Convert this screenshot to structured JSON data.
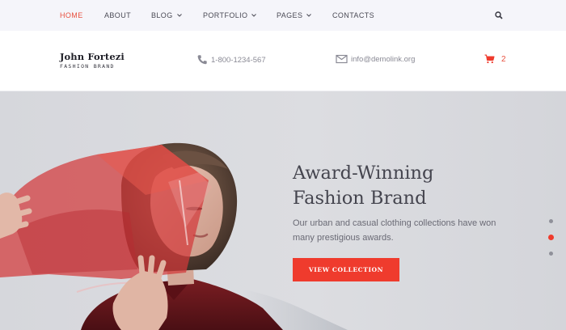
{
  "nav": {
    "items": [
      {
        "label": "HOME",
        "active": true,
        "has_dropdown": false
      },
      {
        "label": "ABOUT",
        "active": false,
        "has_dropdown": false
      },
      {
        "label": "BLOG",
        "active": false,
        "has_dropdown": true
      },
      {
        "label": "PORTFOLIO",
        "active": false,
        "has_dropdown": true
      },
      {
        "label": "PAGES",
        "active": false,
        "has_dropdown": true
      },
      {
        "label": "CONTACTS",
        "active": false,
        "has_dropdown": false
      }
    ],
    "search_icon": "search-icon"
  },
  "brand": {
    "name": "John Fortezi",
    "tagline": "FASHION BRAND"
  },
  "contacts": {
    "phone": "1-800-1234-567",
    "email": "info@demolink.org"
  },
  "cart": {
    "count": "2",
    "icon": "cart-icon"
  },
  "hero": {
    "title_line1": "Award-Winning",
    "title_line2": "Fashion Brand",
    "description": "Our urban and casual clothing collections have won many prestigious awards.",
    "button_label": "VIEW COLLECTION",
    "slides": 3,
    "active_slide": 2
  },
  "colors": {
    "accent": "#ef3b2d",
    "nav_active": "#e8503f",
    "nav_bg": "#f5f5fa",
    "hero_bg": "#d8d9de",
    "text_dark": "#44444e"
  }
}
